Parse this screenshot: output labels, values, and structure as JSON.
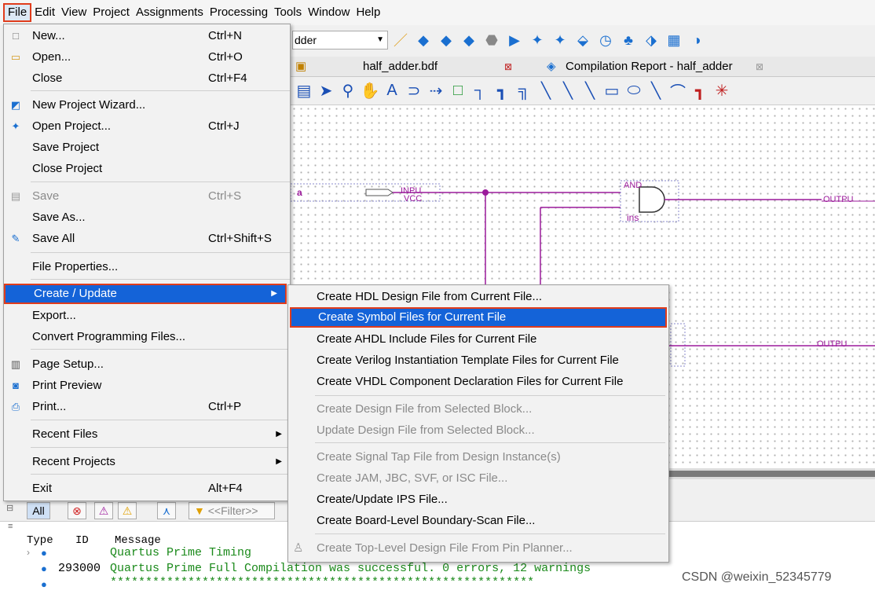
{
  "menubar": [
    "File",
    "Edit",
    "View",
    "Project",
    "Assignments",
    "Processing",
    "Tools",
    "Window",
    "Help"
  ],
  "toolbar": {
    "combo_value": "dder"
  },
  "tabs": [
    {
      "label": "half_adder.bdf"
    },
    {
      "label": "Compilation Report - half_adder"
    }
  ],
  "schematic": {
    "input_name": "a",
    "input_pin_label": "INPU",
    "input_pin_sub": "VCC",
    "gate_label": "AND",
    "inst_label": "ins",
    "output1_label": "OUTPU",
    "output2_label": "OUTPU"
  },
  "file_menu": [
    {
      "label": "New...",
      "shortcut": "Ctrl+N",
      "icon": "new-file-icon"
    },
    {
      "label": "Open...",
      "shortcut": "Ctrl+O",
      "icon": "open-folder-icon"
    },
    {
      "label": "Close",
      "shortcut": "Ctrl+F4"
    },
    {
      "label": "New Project Wizard...",
      "icon": "wizard-icon"
    },
    {
      "label": "Open Project...",
      "shortcut": "Ctrl+J",
      "icon": "open-project-icon"
    },
    {
      "label": "Save Project"
    },
    {
      "label": "Close Project"
    },
    {
      "label": "Save",
      "shortcut": "Ctrl+S",
      "icon": "save-icon",
      "disabled": true
    },
    {
      "label": "Save As..."
    },
    {
      "label": "Save All",
      "shortcut": "Ctrl+Shift+S",
      "icon": "save-all-icon"
    },
    {
      "label": "File Properties..."
    },
    {
      "label": "Create / Update",
      "submenu": true
    },
    {
      "label": "Export..."
    },
    {
      "label": "Convert Programming Files..."
    },
    {
      "label": "Page Setup...",
      "icon": "page-setup-icon"
    },
    {
      "label": "Print Preview",
      "icon": "print-preview-icon"
    },
    {
      "label": "Print...",
      "shortcut": "Ctrl+P",
      "icon": "printer-icon"
    },
    {
      "label": "Recent Files",
      "submenu": true
    },
    {
      "label": "Recent Projects",
      "submenu": true
    },
    {
      "label": "Exit",
      "shortcut": "Alt+F4"
    }
  ],
  "submenu": [
    {
      "label": "Create HDL Design File from Current File..."
    },
    {
      "label": "Create Symbol Files for Current File"
    },
    {
      "label": "Create AHDL Include Files for Current File"
    },
    {
      "label": "Create Verilog Instantiation Template Files for Current File"
    },
    {
      "label": "Create VHDL Component Declaration Files for Current File"
    },
    {
      "label": "Create Design File from Selected Block...",
      "disabled": true
    },
    {
      "label": "Update Design File from Selected Block...",
      "disabled": true
    },
    {
      "label": "Create Signal Tap File from Design Instance(s)",
      "disabled": true
    },
    {
      "label": "Create JAM, JBC, SVF, or ISC File...",
      "disabled": true
    },
    {
      "label": "Create/Update IPS File..."
    },
    {
      "label": "Create Board-Level Boundary-Scan File..."
    },
    {
      "label": "Create Top-Level Design File From Pin Planner...",
      "disabled": true
    }
  ],
  "messages": {
    "filter_all": "All",
    "filter_placeholder": "<<Filter>>",
    "col_type": "Type",
    "col_id": "ID",
    "col_message": "Message",
    "rows": [
      {
        "id": "",
        "text": "Quartus Prime Timing"
      },
      {
        "id": "293000",
        "text": "Quartus Prime Full Compilation was successful. 0 errors, 12 warnings"
      },
      {
        "id": "",
        "text": "************************************************************"
      }
    ]
  },
  "watermark": "CSDN @weixin_52345779",
  "colors": {
    "highlight": "#1463d8",
    "callout": "#e03c1c",
    "wire": "#9b1a9b"
  }
}
